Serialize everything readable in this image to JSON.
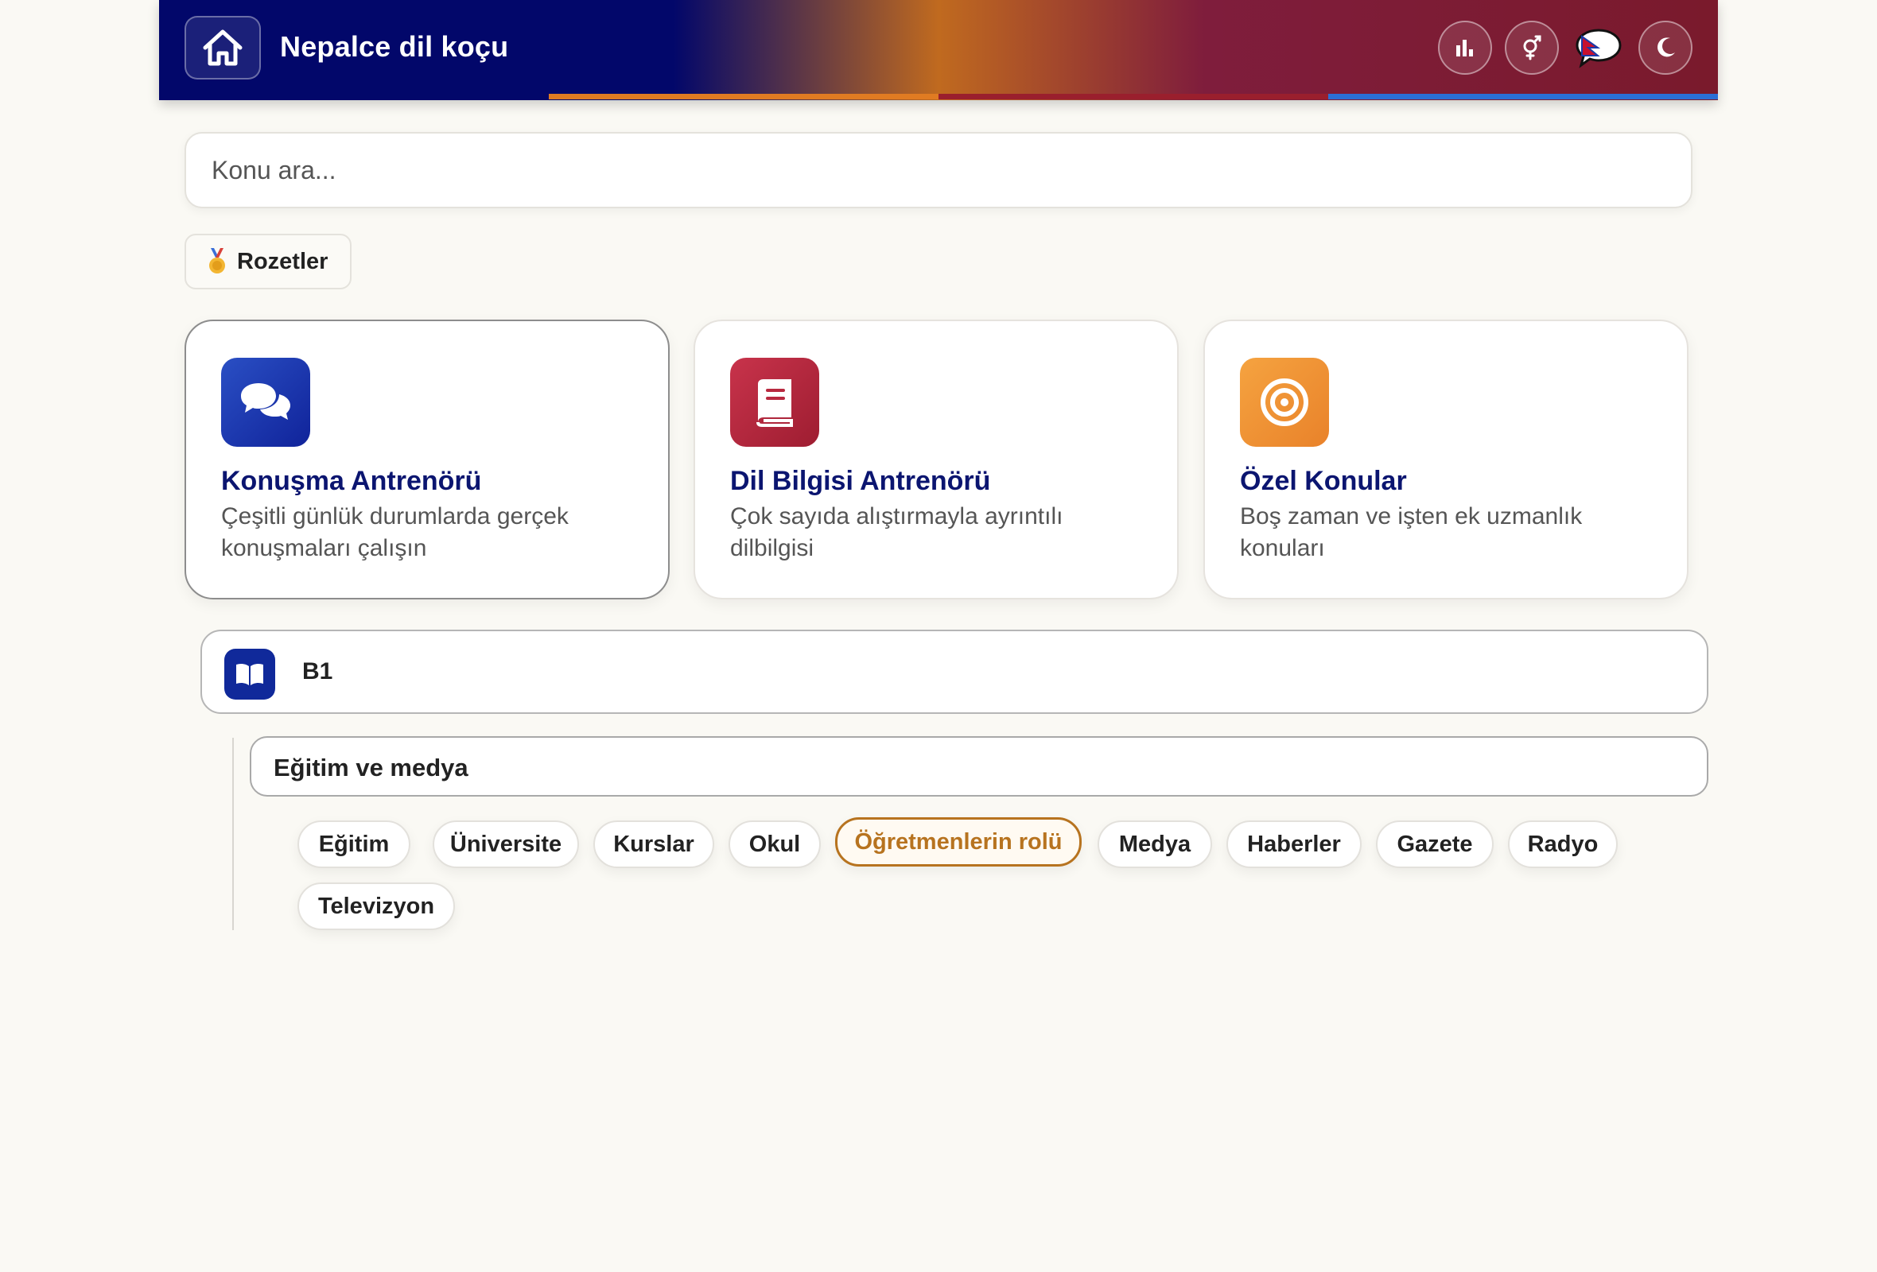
{
  "app": {
    "title": "Nepalce dil koçu"
  },
  "header": {
    "gradient_colors": [
      "#02076a",
      "#c06a1f",
      "#7f1d3c"
    ],
    "stripe_colors": [
      "#02076a",
      "#e07b22",
      "#9a1f2d",
      "#2b6fd6"
    ],
    "buttons": [
      {
        "name": "stats-button",
        "icon": "bar-chart-icon"
      },
      {
        "name": "gender-button",
        "icon": "gender-icon"
      },
      {
        "name": "language-button",
        "icon": "nepal-flag-speech-icon"
      },
      {
        "name": "dark-mode-button",
        "icon": "moon-icon"
      }
    ]
  },
  "search": {
    "placeholder": "Konu ara..."
  },
  "badges": {
    "label": "Rozetler",
    "icon": "medal-icon"
  },
  "cards": [
    {
      "title": "Konuşma Antrenörü",
      "description": "Çeşitli günlük durumlarda gerçek konuşmaları çalışın",
      "icon": "chat-bubbles-icon",
      "color": "#1b3aa8"
    },
    {
      "title": "Dil Bilgisi Antrenörü",
      "description": "Çok sayıda alıştırmayla ayrıntılı dilbilgisi",
      "icon": "book-icon",
      "color": "#b8293f"
    },
    {
      "title": "Özel Konular",
      "description": "Boş zaman ve işten ek uzmanlık konuları",
      "icon": "target-icon",
      "color": "#f0902e"
    }
  ],
  "level": {
    "label": "B1",
    "icon": "open-book-icon"
  },
  "category": {
    "label": "Eğitim ve medya"
  },
  "topics": [
    {
      "label": "Eğitim",
      "selected": false
    },
    {
      "label": "Üniversite",
      "selected": false
    },
    {
      "label": "Kurslar",
      "selected": false
    },
    {
      "label": "Okul",
      "selected": false
    },
    {
      "label": "Öğretmenlerin rolü",
      "selected": true
    },
    {
      "label": "Medya",
      "selected": false
    },
    {
      "label": "Haberler",
      "selected": false
    },
    {
      "label": "Gazete",
      "selected": false
    },
    {
      "label": "Radyo",
      "selected": false
    },
    {
      "label": "Televizyon",
      "selected": false
    }
  ]
}
